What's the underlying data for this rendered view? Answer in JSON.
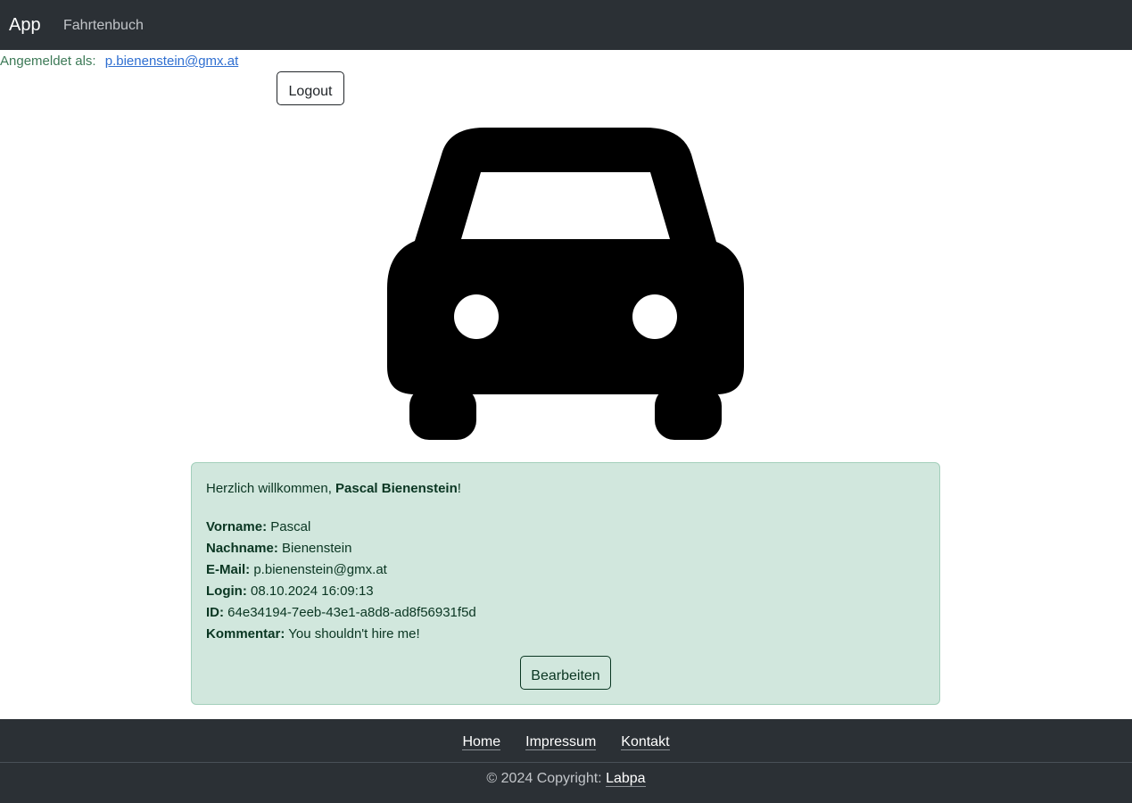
{
  "navbar": {
    "brand": "App",
    "links": [
      "Fahrtenbuch"
    ]
  },
  "session": {
    "label": "Angemeldet als:",
    "email": "p.bienenstein@gmx.at",
    "logout_label": "Logout"
  },
  "hero": {
    "icon": "car-icon"
  },
  "profile": {
    "greeting_prefix": "Herzlich willkommen, ",
    "greeting_name": "Pascal Bienenstein",
    "greeting_suffix": "!",
    "fields": [
      {
        "label": "Vorname:",
        "value": "Pascal"
      },
      {
        "label": "Nachname:",
        "value": "Bienenstein"
      },
      {
        "label": "E-Mail:",
        "value": "p.bienenstein@gmx.at"
      },
      {
        "label": "Login:",
        "value": "08.10.2024 16:09:13"
      },
      {
        "label": "ID:",
        "value": "64e34194-7eeb-43e1-a8d8-ad8f56931f5d"
      },
      {
        "label": "Kommentar:",
        "value": "You shouldn't hire me!"
      }
    ],
    "edit_label": "Bearbeiten"
  },
  "footer": {
    "links": [
      "Home",
      "Impressum",
      "Kontakt"
    ],
    "copyright_prefix": "© 2024 Copyright:",
    "copyright_owner": "Labpa"
  },
  "colors": {
    "navbar_bg": "#2b3035",
    "card_bg": "#d1e7dd",
    "card_text": "#0a3622",
    "session_text": "#3d7a57",
    "link": "#2f6fd1"
  }
}
